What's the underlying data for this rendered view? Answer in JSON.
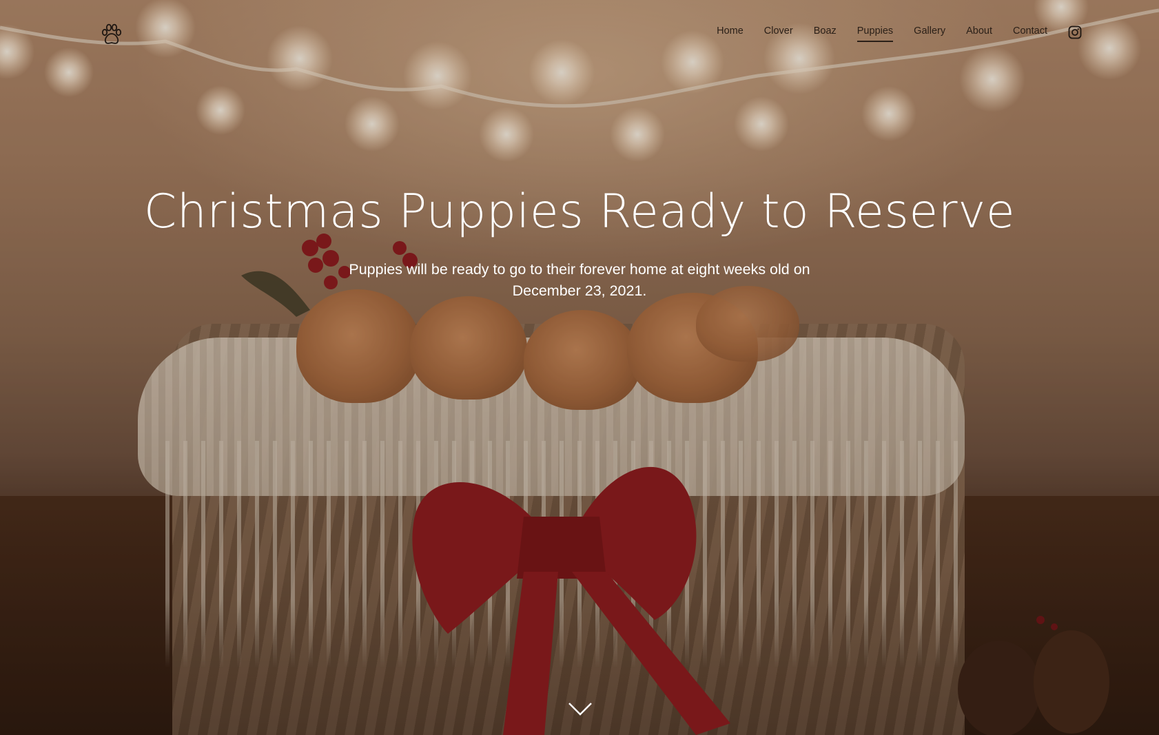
{
  "header": {
    "logo_icon": "paw-print-icon",
    "nav": [
      {
        "label": "Home",
        "active": false
      },
      {
        "label": "Clover",
        "active": false
      },
      {
        "label": "Boaz",
        "active": false
      },
      {
        "label": "Puppies",
        "active": true
      },
      {
        "label": "Gallery",
        "active": false
      },
      {
        "label": "About",
        "active": false
      },
      {
        "label": "Contact",
        "active": false
      }
    ],
    "social_icon": "instagram-icon"
  },
  "hero": {
    "title": "Christmas Puppies Ready to Reserve",
    "subtitle": "Puppies will be ready to go to their forever home at eight weeks old on December 23, 2021.",
    "scroll_icon": "chevron-down-icon"
  },
  "colors": {
    "nav_text": "#2b2018",
    "hero_text": "#ffffff",
    "bow_red": "#8e1a1f"
  }
}
